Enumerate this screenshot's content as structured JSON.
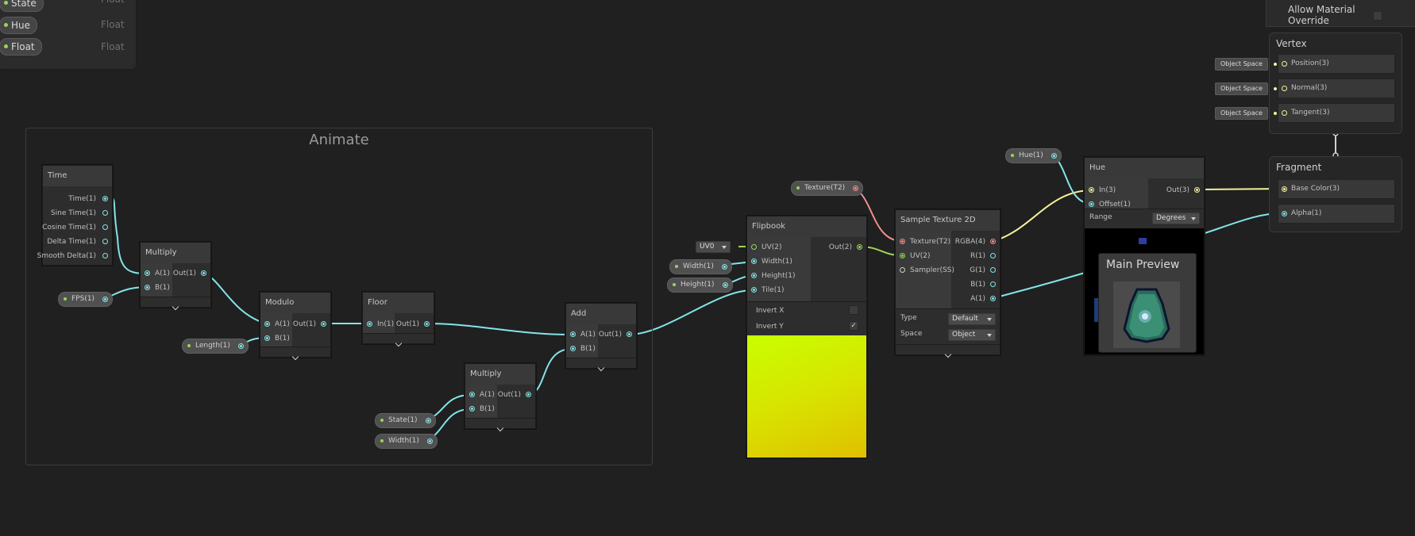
{
  "blackboard": {
    "properties": [
      {
        "name": "State",
        "type": "Float"
      },
      {
        "name": "Hue",
        "type": "Float"
      },
      {
        "name": "Float",
        "type": "Float"
      }
    ]
  },
  "group": {
    "title": "Animate"
  },
  "nodes": {
    "time": {
      "title": "Time",
      "outputs": [
        "Time(1)",
        "Sine Time(1)",
        "Cosine Time(1)",
        "Delta Time(1)",
        "Smooth Delta(1)"
      ]
    },
    "multiply1": {
      "title": "Multiply",
      "inputs": [
        "A(1)",
        "B(1)"
      ],
      "output": "Out(1)"
    },
    "modulo": {
      "title": "Modulo",
      "inputs": [
        "A(1)",
        "B(1)"
      ],
      "output": "Out(1)"
    },
    "floor": {
      "title": "Floor",
      "inputs": [
        "In(1)"
      ],
      "output": "Out(1)"
    },
    "multiply2": {
      "title": "Multiply",
      "inputs": [
        "A(1)",
        "B(1)"
      ],
      "output": "Out(1)"
    },
    "add": {
      "title": "Add",
      "inputs": [
        "A(1)",
        "B(1)"
      ],
      "output": "Out(1)"
    },
    "flipbook": {
      "title": "Flipbook",
      "inputs": [
        "UV(2)",
        "Width(1)",
        "Height(1)",
        "Tile(1)"
      ],
      "output": "Out(2)",
      "invert_x_label": "Invert X",
      "invert_y_label": "Invert Y",
      "invert_x": false,
      "invert_y": true,
      "uv_dropdown": "UV0"
    },
    "sample": {
      "title": "Sample Texture 2D",
      "inputs": [
        "Texture(T2)",
        "UV(2)",
        "Sampler(SS)"
      ],
      "outputs": [
        "RGBA(4)",
        "R(1)",
        "G(1)",
        "B(1)",
        "A(1)"
      ],
      "type_label": "Type",
      "type_value": "Default",
      "space_label": "Space",
      "space_value": "Object"
    },
    "hue": {
      "title": "Hue",
      "inputs": [
        "In(3)",
        "Offset(1)"
      ],
      "output": "Out(3)",
      "range_label": "Range",
      "range_value": "Degrees"
    }
  },
  "pills": {
    "fps": "FPS(1)",
    "length": "Length(1)",
    "state": "State(1)",
    "width_group": "Width(1)",
    "width_fb": "Width(1)",
    "height_fb": "Height(1)",
    "texture": "Texture(T2)",
    "hue": "Hue(1)"
  },
  "preview": {
    "title": "Main Preview"
  },
  "master": {
    "allow_material_override": "Allow Material Override",
    "vertex_title": "Vertex",
    "vertex_blocks": [
      "Position(3)",
      "Normal(3)",
      "Tangent(3)"
    ],
    "vertex_space": "Object Space",
    "fragment_title": "Fragment",
    "fragment_blocks": [
      "Base Color(3)",
      "Alpha(1)"
    ]
  },
  "colors": {
    "float_port": "#84e4e7",
    "vector2_port": "#9bd35a",
    "vector3_port": "#f4f19a",
    "texture_port": "#f08f8f"
  }
}
